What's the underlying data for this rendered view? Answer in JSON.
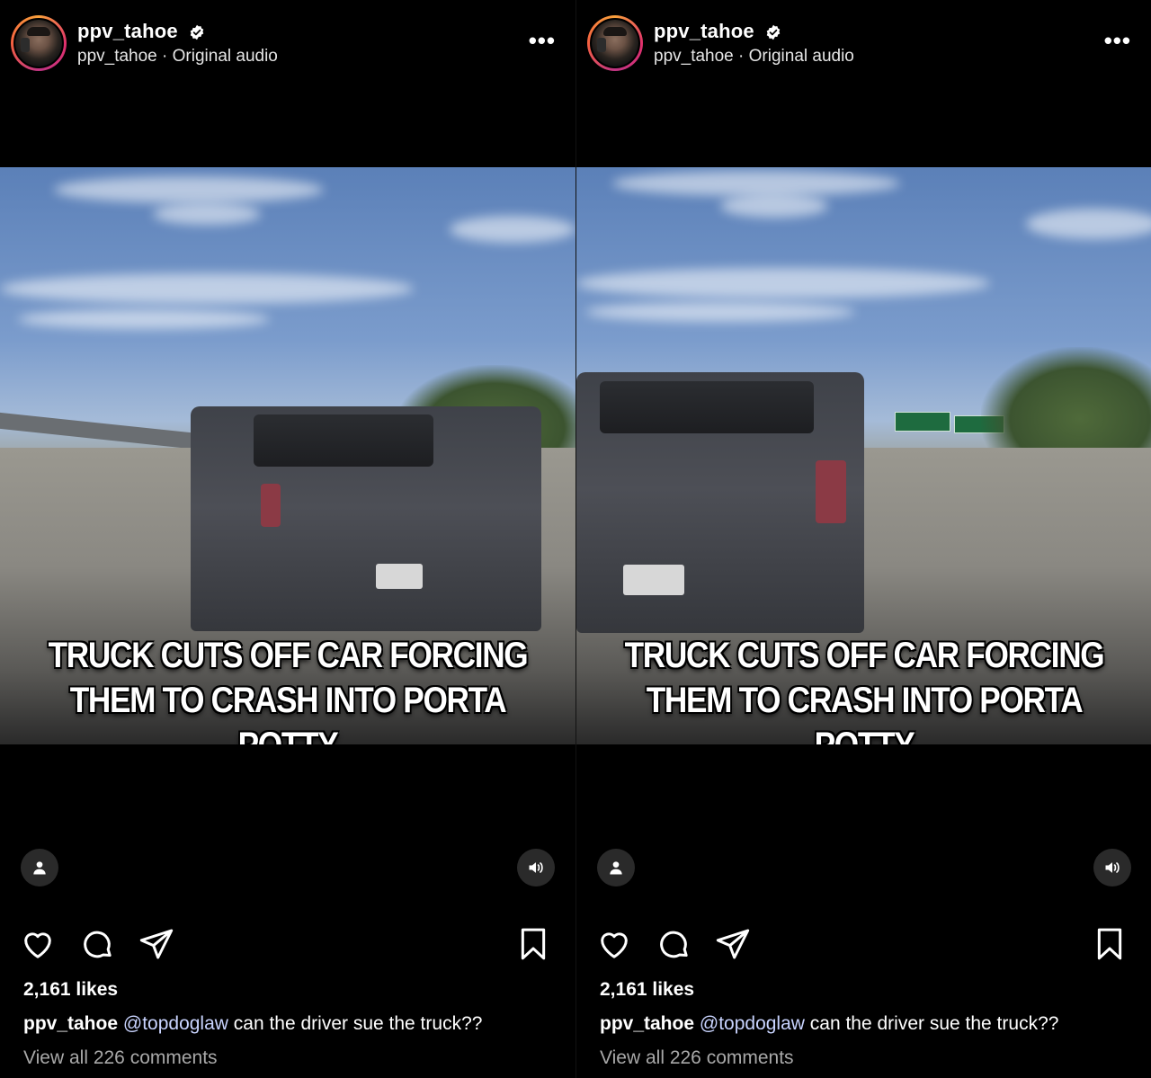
{
  "panels": [
    {
      "post": {
        "username": "ppv_tahoe",
        "subline": "ppv_tahoe · Original audio",
        "more_label": "•••"
      },
      "video": {
        "caption_line1": "TRUCK CUTS OFF CAR FORCING",
        "caption_line2": "THEM TO CRASH INTO PORTA POTTY"
      },
      "footer": {
        "likes": "2,161 likes",
        "caption_user": "ppv_tahoe",
        "caption_mention": "@topdoglaw",
        "caption_text": " can the driver sue the truck??",
        "view_comments": "View all 226 comments"
      }
    },
    {
      "post": {
        "username": "ppv_tahoe",
        "subline": "ppv_tahoe · Original audio",
        "more_label": "•••"
      },
      "video": {
        "caption_line1": "TRUCK CUTS OFF CAR FORCING",
        "caption_line2": "THEM TO CRASH INTO PORTA POTTY"
      },
      "footer": {
        "likes": "2,161 likes",
        "caption_user": "ppv_tahoe",
        "caption_mention": "@topdoglaw",
        "caption_text": " can the driver sue the truck??",
        "view_comments": "View all 226 comments"
      }
    }
  ],
  "icons": {
    "verified": "verified-badge-icon",
    "more": "more-options-icon",
    "user_tag": "user-tag-icon",
    "audio": "speaker-icon",
    "like": "heart-icon",
    "comment": "comment-icon",
    "share": "send-icon",
    "save": "bookmark-icon"
  },
  "colors": {
    "background": "#000000",
    "text": "#ffffff",
    "muted_text": "#a8a8a8",
    "mention": "#c9d4ff",
    "story_ring": "#e1306c"
  }
}
